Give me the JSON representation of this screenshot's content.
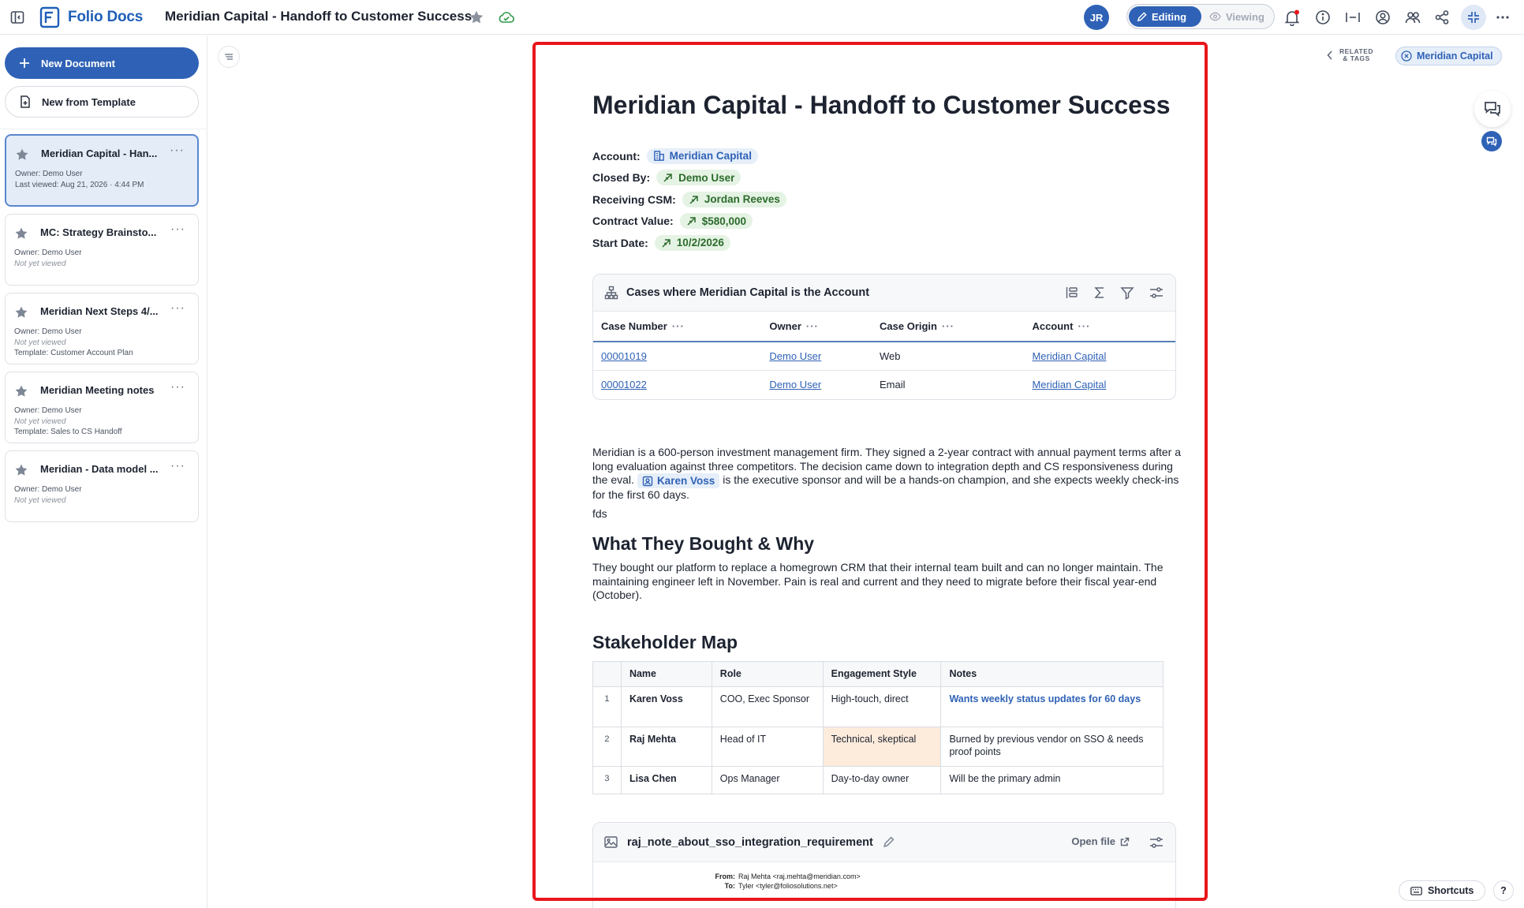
{
  "app": {
    "logo_text": "Folio Docs",
    "document_title": "Meridian Capital - Handoff to Customer Success",
    "user_initials": "JR",
    "mode_editing": "Editing",
    "mode_viewing": "Viewing",
    "accent_color": "#2f62b6"
  },
  "sidebar": {
    "new_document_label": "New Document",
    "new_from_template_label": "New from Template",
    "documents": [
      {
        "title": "Meridian Capital - Han...",
        "owner": "Owner: Demo User",
        "viewed": "Last viewed: Aug 21, 2026 · 4:44 PM",
        "template": "",
        "selected": true
      },
      {
        "title": "MC: Strategy Brainsto...",
        "owner": "Owner: Demo User",
        "viewed": "Not yet viewed",
        "template": "",
        "selected": false
      },
      {
        "title": "Meridian Next Steps 4/...",
        "owner": "Owner: Demo User",
        "viewed": "Not yet viewed",
        "template": "Template: Customer Account Plan",
        "selected": false
      },
      {
        "title": "Meridian Meeting notes",
        "owner": "Owner: Demo User",
        "viewed": "Not yet viewed",
        "template": "Template: Sales to CS Handoff",
        "selected": false
      },
      {
        "title": "Meridian - Data model ...",
        "owner": "Owner: Demo User",
        "viewed": "Not yet viewed",
        "template": "",
        "selected": false
      }
    ]
  },
  "document": {
    "heading": "Meridian Capital - Handoff to Customer Success",
    "fields": [
      {
        "label": "Account:",
        "value": "Meridian Capital",
        "style": "blue"
      },
      {
        "label": "Closed By:",
        "value": "Demo User",
        "style": "green"
      },
      {
        "label": "Receiving CSM:",
        "value": "Jordan Reeves",
        "style": "green"
      },
      {
        "label": "Contract Value:",
        "value": "$580,000",
        "style": "green"
      },
      {
        "label": "Start Date:",
        "value": "10/2/2026",
        "style": "green"
      }
    ],
    "cases": {
      "title": "Cases where Meridian Capital is the Account",
      "columns": [
        "Case Number",
        "Owner",
        "Case Origin",
        "Account"
      ],
      "rows": [
        [
          "00001019",
          "Demo User",
          "Web",
          "Meridian Capital"
        ],
        [
          "00001022",
          "Demo User",
          "Email",
          "Meridian Capital"
        ]
      ]
    },
    "intro_part1": "Meridian is a 600-person investment management firm. They signed a 2-year contract with annual payment terms after a long evaluation against three competitors. The decision came down to integration depth and CS responsiveness during the eval.",
    "intro_mention": "Karen Voss",
    "intro_part2": "is the executive sponsor and will be a hands-on champion, and she expects weekly check-ins for the first 60 days.",
    "stray_text": "fds",
    "section1_heading": "What They Bought & Why",
    "section1_body": "They bought our platform to replace a homegrown CRM that their internal team built and can no longer maintain. The maintaining engineer left in November. Pain is real and current and they need to migrate before their fiscal year-end (October).",
    "section2_heading": "Stakeholder Map",
    "stakeholders": {
      "columns": [
        "",
        "Name",
        "Role",
        "Engagement Style",
        "Notes"
      ],
      "rows": [
        {
          "n": "1",
          "name": "Karen Voss",
          "role": "COO, Exec Sponsor",
          "style": "High-touch, direct",
          "notes": "Wants weekly status updates for 60 days"
        },
        {
          "n": "2",
          "name": "Raj Mehta",
          "role": "Head of IT",
          "style": "Technical, skeptical",
          "notes": "Burned by previous vendor on SSO & needs proof points"
        },
        {
          "n": "3",
          "name": "Lisa Chen",
          "role": "Ops Manager",
          "style": "Day-to-day owner",
          "notes": "Will be the primary admin"
        }
      ]
    },
    "file": {
      "name": "raj_note_about_sso_integration_requirement",
      "open_label": "Open file",
      "preview_from_label": "From:",
      "preview_from": "Raj Mehta <raj.mehta@meridian.com>",
      "preview_to_label": "To:",
      "preview_to": "Tyler <tyler@foliosolutions.net>"
    }
  },
  "right": {
    "related_line1": "RELATED",
    "related_line2": "& TAGS",
    "related_tag": "Meridian Capital",
    "shortcuts_label": "Shortcuts",
    "help_label": "?"
  }
}
